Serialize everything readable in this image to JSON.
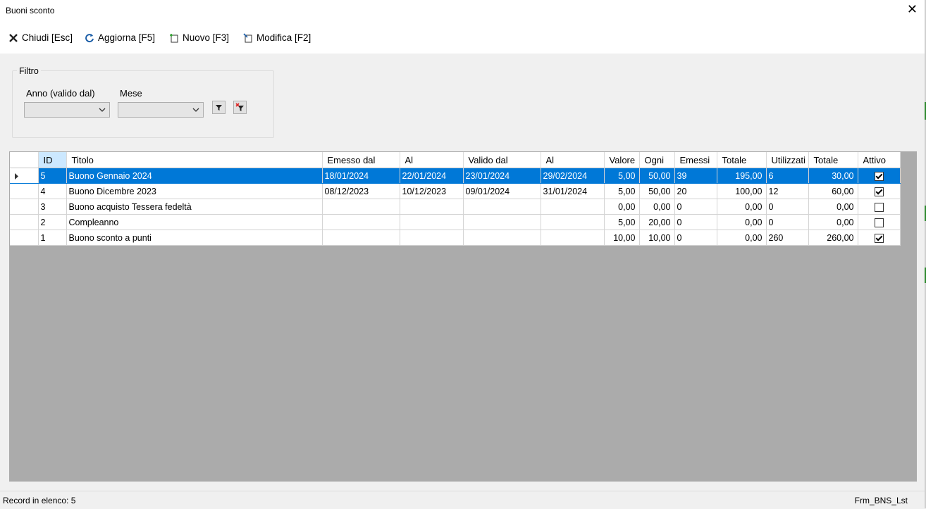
{
  "window": {
    "title": "Buoni sconto"
  },
  "toolbar": {
    "close_label": "Chiudi [Esc]",
    "refresh_label": "Aggiorna [F5]",
    "new_label": "Nuovo [F3]",
    "edit_label": "Modifica [F2]"
  },
  "filter": {
    "legend": "Filtro",
    "year_label": "Anno (valido dal)",
    "year_value": "",
    "month_label": "Mese",
    "month_value": ""
  },
  "grid": {
    "columns": [
      "ID",
      "Titolo",
      "Emesso dal",
      "Al",
      "Valido dal",
      "Al",
      "Valore",
      "Ogni",
      "Emessi",
      "Totale",
      "Utilizzati",
      "Totale",
      "Attivo"
    ],
    "selected_row": 0,
    "rows": [
      {
        "id": "5",
        "titolo": "Buono Gennaio 2024",
        "emesso_dal": "18/01/2024",
        "al": "22/01/2024",
        "valido_dal": "23/01/2024",
        "valido_al": "29/02/2024",
        "valore": "5,00",
        "ogni": "50,00",
        "emessi": "39",
        "totale_emessi": "195,00",
        "utilizzati": "6",
        "totale_utilizzati": "30,00",
        "attivo": true
      },
      {
        "id": "4",
        "titolo": "Buono Dicembre 2023",
        "emesso_dal": "08/12/2023",
        "al": "10/12/2023",
        "valido_dal": "09/01/2024",
        "valido_al": "31/01/2024",
        "valore": "5,00",
        "ogni": "50,00",
        "emessi": "20",
        "totale_emessi": "100,00",
        "utilizzati": "12",
        "totale_utilizzati": "60,00",
        "attivo": true
      },
      {
        "id": "3",
        "titolo": "Buono acquisto Tessera fedeltà",
        "emesso_dal": "",
        "al": "",
        "valido_dal": "",
        "valido_al": "",
        "valore": "0,00",
        "ogni": "0,00",
        "emessi": "0",
        "totale_emessi": "0,00",
        "utilizzati": "0",
        "totale_utilizzati": "0,00",
        "attivo": false
      },
      {
        "id": "2",
        "titolo": "Compleanno",
        "emesso_dal": "",
        "al": "",
        "valido_dal": "",
        "valido_al": "",
        "valore": "5,00",
        "ogni": "20,00",
        "emessi": "0",
        "totale_emessi": "0,00",
        "utilizzati": "0",
        "totale_utilizzati": "0,00",
        "attivo": false
      },
      {
        "id": "1",
        "titolo": "Buono sconto a punti",
        "emesso_dal": "",
        "al": "",
        "valido_dal": "",
        "valido_al": "",
        "valore": "10,00",
        "ogni": "10,00",
        "emessi": "0",
        "totale_emessi": "0,00",
        "utilizzati": "260",
        "totale_utilizzati": "260,00",
        "attivo": true
      }
    ]
  },
  "status": {
    "record_count": "Record in elenco: 5",
    "form_name": "Frm_BNS_Lst"
  },
  "icons": {
    "close": "close-icon",
    "refresh": "refresh-icon",
    "new": "new-document-icon",
    "edit": "edit-document-icon",
    "apply_filter": "filter-icon",
    "clear_filter": "clear-filter-icon"
  },
  "colors": {
    "selection": "#0078d7",
    "grid_background": "#ababab",
    "header_selected": "#cce8ff"
  }
}
